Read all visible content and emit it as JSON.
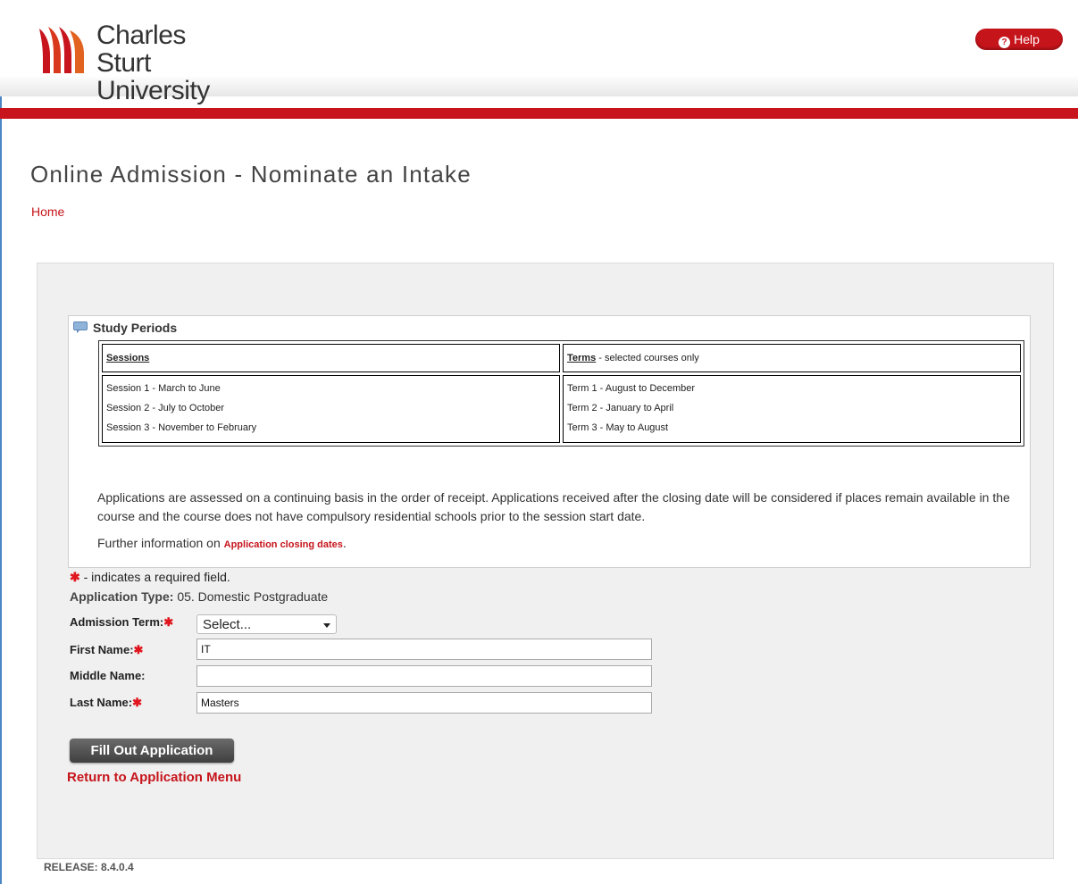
{
  "header": {
    "logo_line1": "Charles Sturt",
    "logo_line2": "University",
    "help_label": "Help"
  },
  "page": {
    "title": "Online Admission - Nominate an Intake",
    "breadcrumb_home": "Home"
  },
  "study_periods": {
    "heading": "Study Periods",
    "sessions_header": "Sessions",
    "terms_header": "Terms",
    "terms_header_suffix": " - selected courses only",
    "sessions": [
      "Session 1 - March to June",
      "Session 2 - July to October",
      "Session 3 - November to February"
    ],
    "terms": [
      "Term 1 - August to December",
      "Term 2 - January to April",
      "Term 3 - May to August"
    ],
    "note": "Applications are assessed on a continuing basis in the order of receipt. Applications received after the closing date will be considered if places remain available in the course and the course does not have compulsory residential schools prior to the session start date.",
    "further_prefix": "Further information on ",
    "further_link": "Application closing dates",
    "further_suffix": "."
  },
  "form": {
    "required_note": " - indicates a required field.",
    "application_type_label": "Application Type:",
    "application_type_value": "05. Domestic Postgraduate",
    "admission_term_label": "Admission Term:",
    "admission_term_value": "Select...",
    "first_name_label": "First Name:",
    "first_name_value": "IT",
    "middle_name_label": "Middle Name:",
    "middle_name_value": "",
    "last_name_label": "Last Name:",
    "last_name_value": "Masters",
    "submit_label": "Fill Out Application",
    "return_label": "Return to Application Menu"
  },
  "footer": {
    "release": "RELEASE: 8.4.0.4"
  },
  "colors": {
    "brand_red": "#c8141d",
    "panel_bg": "#f0f0f0"
  }
}
